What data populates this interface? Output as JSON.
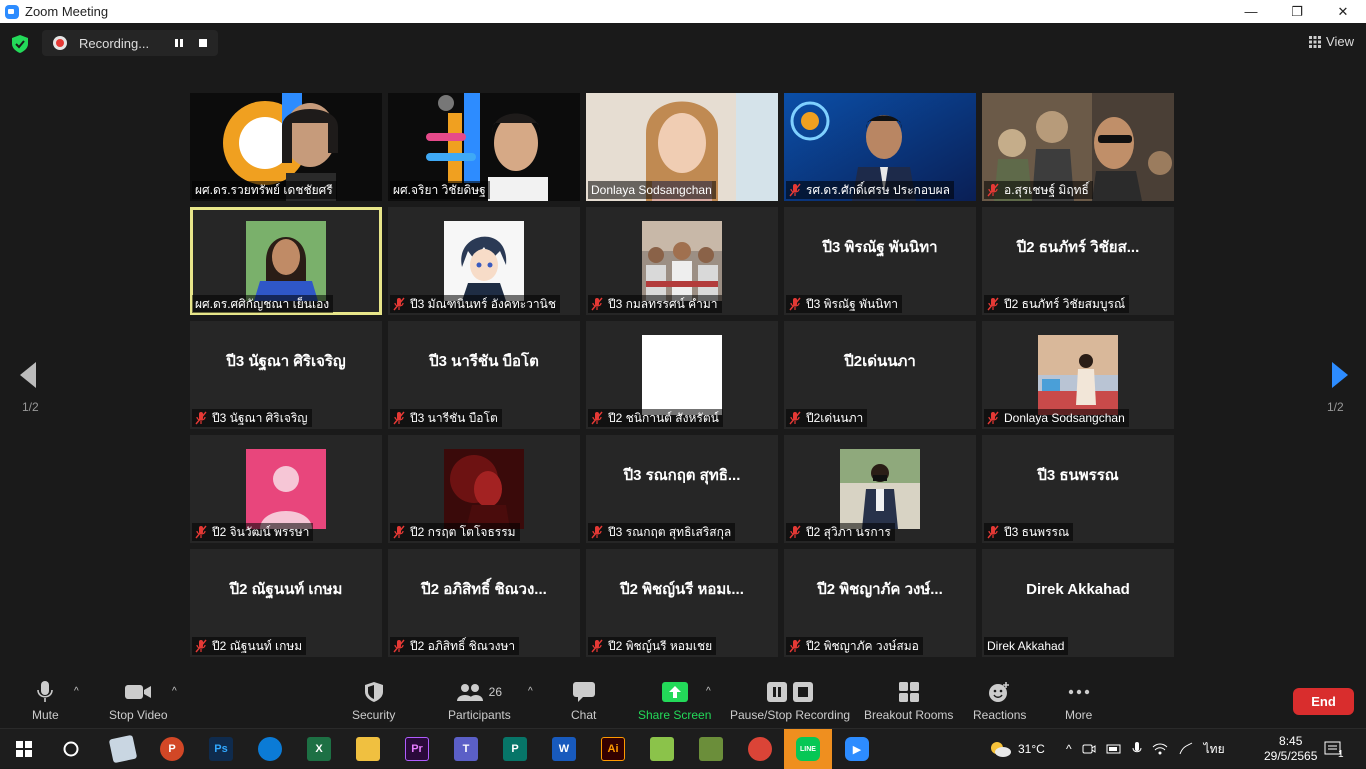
{
  "window": {
    "title": "Zoom Meeting",
    "minimize": "—",
    "maximize": "❐",
    "close": "✕"
  },
  "topbar": {
    "recording_label": "Recording...",
    "view_label": "View"
  },
  "pager": {
    "left_text": "1/2",
    "right_text": "1/2"
  },
  "tiles": [
    {
      "name": "ผศ.ดร.รวยทรัพย์ เดชชัยศรี",
      "muted": false,
      "kind": "video"
    },
    {
      "name": "ผศ.จริยา วิชัยดิษฐ",
      "muted": false,
      "kind": "video"
    },
    {
      "name": "Donlaya Sodsangchan",
      "muted": false,
      "kind": "video"
    },
    {
      "name": "รศ.ดร.ศักดิ์เศรษ ประกอบผล",
      "muted": true,
      "kind": "video"
    },
    {
      "name": "อ.สุรเชษฐ์ มิฤทธิ์",
      "muted": true,
      "kind": "video"
    },
    {
      "name": "ผศ.ดร.ศศิกัญชณา เย็นเอง",
      "muted": false,
      "kind": "thumb",
      "active": true
    },
    {
      "name": "ปี3 มัณฑนินทร์ อังคทะวานิช",
      "muted": true,
      "kind": "thumb"
    },
    {
      "name": "ปี3 กมลทรรศน์ คำมา",
      "muted": true,
      "kind": "thumb"
    },
    {
      "name": "ปี3 พิรณัฐ พันนิทา",
      "muted": true,
      "kind": "text",
      "display": "ปี3 พิรณัฐ พันนิทา"
    },
    {
      "name": "ปี2 ธนภัทร์ วิชัยสมบูรณ์",
      "muted": true,
      "kind": "text",
      "display": "ปี2 ธนภัทร์ วิชัยส..."
    },
    {
      "name": "ปี3 นัฐณา ศิริเจริญ",
      "muted": true,
      "kind": "text",
      "display": "ปี3 นัฐณา ศิริเจริญ"
    },
    {
      "name": "ปี3 นารีชัน บือโต",
      "muted": true,
      "kind": "text",
      "display": "ปี3 นารีชัน บือโต"
    },
    {
      "name": "ปี2 ชนิกานต์ สังหรัตน์",
      "muted": true,
      "kind": "thumb"
    },
    {
      "name": "ปี2เด่นนภา",
      "muted": true,
      "kind": "text",
      "display": "ปี2เด่นนภา"
    },
    {
      "name": "Donlaya Sodsangchan",
      "muted": true,
      "kind": "thumb"
    },
    {
      "name": "ปี2 จินวัฒน์ พรรษา",
      "muted": true,
      "kind": "thumb"
    },
    {
      "name": "ปี2 กรฤต โตโจธรรม",
      "muted": true,
      "kind": "thumb"
    },
    {
      "name": "ปี3 รณกฤต สุทธิเสริสกุล",
      "muted": true,
      "kind": "text",
      "display": "ปี3 รณกฤต สุทธิ..."
    },
    {
      "name": "ปี2 สุวิภา นรการ",
      "muted": true,
      "kind": "thumb"
    },
    {
      "name": "ปี3 ธนพรรณ",
      "muted": true,
      "kind": "text",
      "display": "ปี3 ธนพรรณ"
    },
    {
      "name": "ปี2 ณัฐนนท์ เกษม",
      "muted": true,
      "kind": "text",
      "display": "ปี2 ณัฐนนท์ เกษม"
    },
    {
      "name": "ปี2 อภิสิทธิ์ ชิณวงษา",
      "muted": true,
      "kind": "text",
      "display": "ปี2 อภิสิทธิ์ ชิณวง..."
    },
    {
      "name": "ปี2 พิชญ์นรี หอมเชย",
      "muted": true,
      "kind": "text",
      "display": "ปี2 พิชญ์นรี หอมเ..."
    },
    {
      "name": "ปี2 พิชญาภัค วงษ์สมอ",
      "muted": true,
      "kind": "text",
      "display": "ปี2 พิชญาภัค วงษ์..."
    },
    {
      "name": "Direk Akkahad",
      "muted": false,
      "kind": "text",
      "display": "Direk Akkahad"
    }
  ],
  "toolbar": {
    "mute": "Mute",
    "stop_video": "Stop Video",
    "security": "Security",
    "participants": "Participants",
    "participants_count": "26",
    "chat": "Chat",
    "share_screen": "Share Screen",
    "pause_recording": "Pause/Stop Recording",
    "breakout": "Breakout Rooms",
    "reactions": "Reactions",
    "more": "More",
    "end": "End"
  },
  "taskbar": {
    "weather": "31°C",
    "language": "ไทย",
    "time": "8:45",
    "date": "29/5/2565",
    "notifications": "1"
  },
  "colors": {
    "accent_blue": "#2d8cff",
    "share_green": "#23d959",
    "end_red": "#d92d2d",
    "active_speaker": "#e8e68a",
    "muted_red": "#e53935"
  }
}
